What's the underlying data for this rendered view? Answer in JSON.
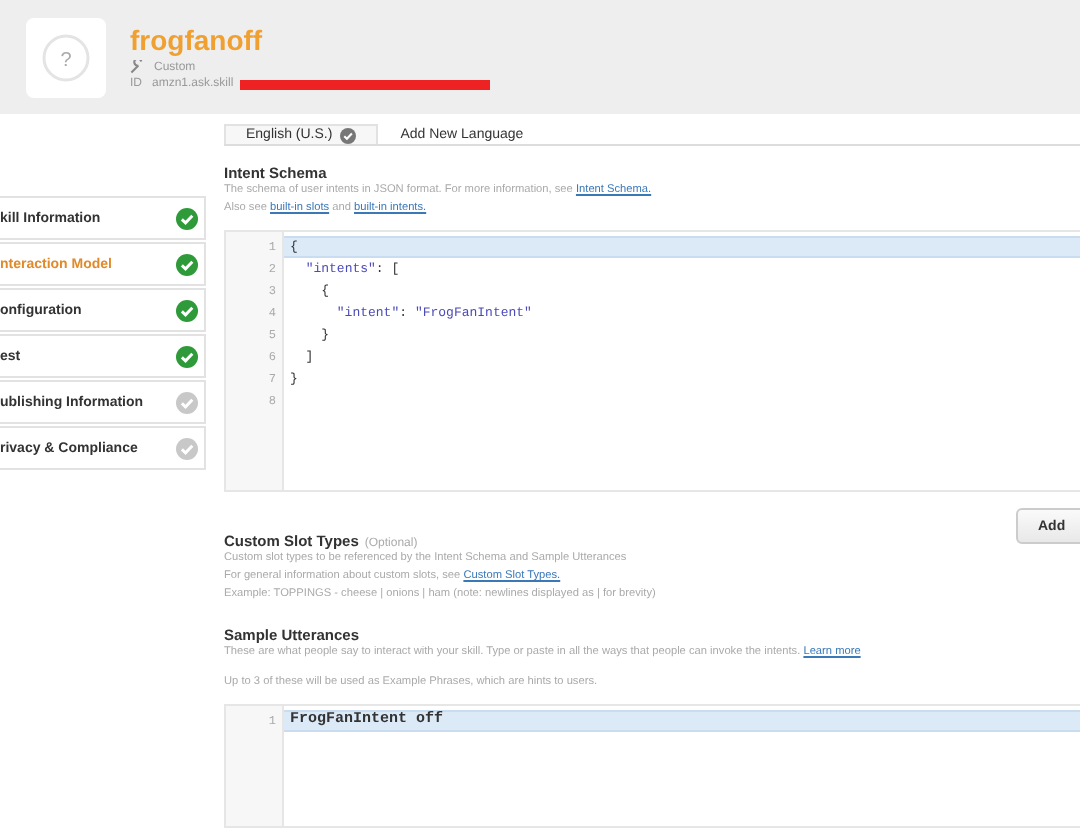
{
  "skill": {
    "logo_glyph": "?",
    "name": "frogfanoff",
    "type": "Custom",
    "id_label": "ID",
    "id_value": "amzn1.ask.skill",
    "id_redacted": true
  },
  "sidebar": {
    "items": [
      {
        "label": "kill Information",
        "selected": false,
        "complete": true
      },
      {
        "label": "nteraction Model",
        "selected": true,
        "complete": true
      },
      {
        "label": "onfiguration",
        "selected": false,
        "complete": true
      },
      {
        "label": "est",
        "selected": false,
        "complete": true
      },
      {
        "label": "ublishing Information",
        "selected": false,
        "complete": false
      },
      {
        "label": "rivacy & Compliance",
        "selected": false,
        "complete": false
      }
    ]
  },
  "tabs": [
    {
      "label": "English (U.S.)",
      "selected": true,
      "complete": true
    },
    {
      "label": "Add New Language",
      "selected": false,
      "complete": false
    }
  ],
  "intent_schema": {
    "title": "Intent Schema",
    "lines": [
      [
        {
          "text": "The schema of user intents in JSON format. For more information, see "
        },
        {
          "text": "Intent Schema.",
          "link": true
        }
      ],
      [
        {
          "text": "Also see "
        },
        {
          "text": "built-in slots",
          "link": true
        },
        {
          "text": " and "
        },
        {
          "text": "built-in intents.",
          "link": true
        }
      ]
    ],
    "code": [
      {
        "number": "1",
        "code": "{",
        "active": true
      },
      {
        "number": "2",
        "code": "  \"intents\": [",
        "active": false
      },
      {
        "number": "3",
        "code": "    {",
        "active": false
      },
      {
        "number": "4",
        "code": "      \"intent\": \"FrogFanIntent\"",
        "active": false
      },
      {
        "number": "5",
        "code": "    }",
        "active": false
      },
      {
        "number": "6",
        "code": "  ]",
        "active": false
      },
      {
        "number": "7",
        "code": "}",
        "active": false
      },
      {
        "number": "8",
        "active": false
      }
    ]
  },
  "custom_slot_types": {
    "title": "Custom Slot Types",
    "optional": "(Optional)",
    "lines": [
      [
        {
          "text": "Custom slot types to be referenced by the Intent Schema and Sample Utterances"
        }
      ],
      [
        {
          "text": "For general information about custom slots, see "
        },
        {
          "text": "Custom Slot Types.",
          "link": true
        }
      ],
      [
        {
          "text": "Example: TOPPINGS - cheese | onions | ham (note: newlines displayed as | for brevity)"
        }
      ]
    ],
    "button": "Add"
  },
  "sample_utterances": {
    "title": "Sample Utterances",
    "lines": [
      [
        {
          "text": "These are what people say to interact with your skill. Type or paste in all the ways that people can invoke the intents. "
        },
        {
          "text": "Learn more",
          "link": true
        }
      ],
      [
        {
          "text": "Up to 3 of these will be used as Example Phrases, which are hints to users."
        }
      ]
    ],
    "code": [
      {
        "number": "1",
        "code": "FrogFanIntent off",
        "active": true
      }
    ]
  }
}
